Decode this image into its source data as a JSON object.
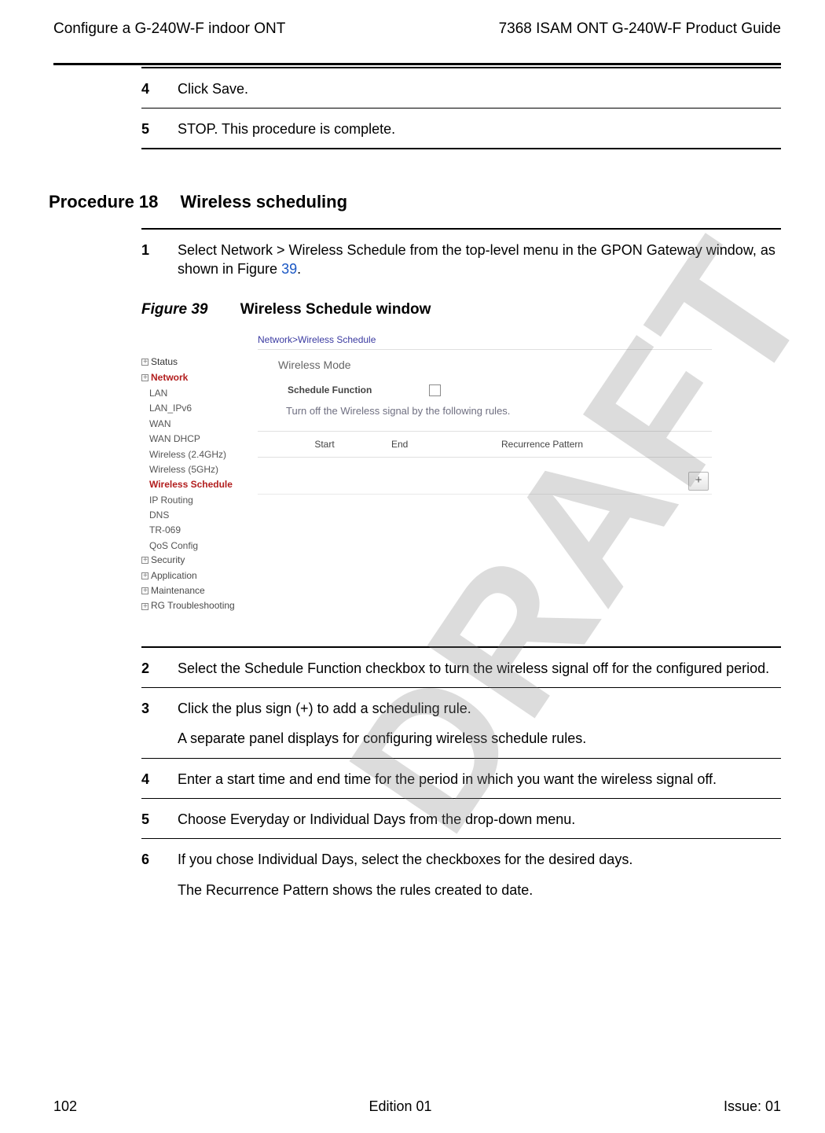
{
  "header": {
    "left": "Configure a G-240W-F indoor ONT",
    "right": "7368 ISAM ONT G-240W-F Product Guide"
  },
  "watermark": "DRAFT",
  "prev_steps": {
    "s4_num": "4",
    "s4_text": "Click Save.",
    "s5_num": "5",
    "s5_text": "STOP. This procedure is complete."
  },
  "procedure": {
    "heading": "Procedure 18  Wireless scheduling"
  },
  "step1": {
    "num": "1",
    "text_before": "Select Network > Wireless Schedule from the top-level menu in the GPON Gateway window, as shown in Figure ",
    "link": "39",
    "text_after": "."
  },
  "figure": {
    "caption_prefix": "Figure 39",
    "caption_title": "Wireless Schedule window"
  },
  "screenshot": {
    "breadcrumb": "Network>Wireless Schedule",
    "panel_title": "Wireless Mode",
    "schedule_label": "Schedule Function",
    "note": "Turn off the Wireless signal by the following rules.",
    "col_start": "Start",
    "col_end": "End",
    "col_rec": "Recurrence Pattern",
    "add_btn": "+",
    "nav": {
      "status": "Status",
      "network": "Network",
      "lan": "LAN",
      "lanipv6": "LAN_IPv6",
      "wan": "WAN",
      "wandhcp": "WAN DHCP",
      "w24": "Wireless (2.4GHz)",
      "w5": "Wireless (5GHz)",
      "wsched": "Wireless Schedule",
      "iprouting": "IP Routing",
      "dns": "DNS",
      "tr069": "TR-069",
      "qos": "QoS Config",
      "security": "Security",
      "application": "Application",
      "maintenance": "Maintenance",
      "rgts": "RG Troubleshooting"
    }
  },
  "steps": {
    "s2_num": "2",
    "s2_text": "Select the Schedule Function checkbox to turn the wireless signal off for the configured period.",
    "s3_num": "3",
    "s3_text": "Click the plus sign (+) to add a scheduling rule.",
    "s3_note": "A separate panel displays for configuring wireless schedule rules.",
    "s4_num": "4",
    "s4_text": "Enter a start time and end time for the period in which you want the wireless signal off.",
    "s5_num": "5",
    "s5_text": "Choose Everyday or Individual Days from the drop-down menu.",
    "s6_num": "6",
    "s6_text": "If you chose Individual Days, select the checkboxes for the desired days.",
    "s6_note": "The Recurrence Pattern shows the rules created to date."
  },
  "footer": {
    "left": "102",
    "center": "Edition 01",
    "right": "Issue: 01"
  }
}
